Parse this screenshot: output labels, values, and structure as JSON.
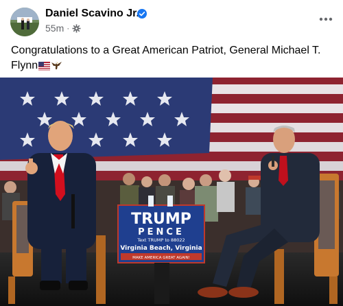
{
  "post": {
    "author": "Daniel Scavino Jr.",
    "time": "55m",
    "separator": "·",
    "text": "Congratulations to a Great American Patriot, General Michael T. Flynn",
    "audience_icon": "public-gear-icon",
    "verified_icon": "verified-badge-icon",
    "more_icon": "more-options-icon"
  },
  "photo": {
    "sign": {
      "line1": "TRUMP",
      "line2": "PENCE",
      "line3": "Text TRUMP to 88022",
      "line4": "Virginia Beach, Virginia",
      "line5": "MAKE AMERICA GREAT AGAIN!"
    }
  },
  "colors": {
    "accent": "#1877f2",
    "secondary_text": "#65676b",
    "flag_red": "#b22234",
    "flag_blue": "#2b3a75",
    "sign_blue": "#1f3f8f"
  }
}
